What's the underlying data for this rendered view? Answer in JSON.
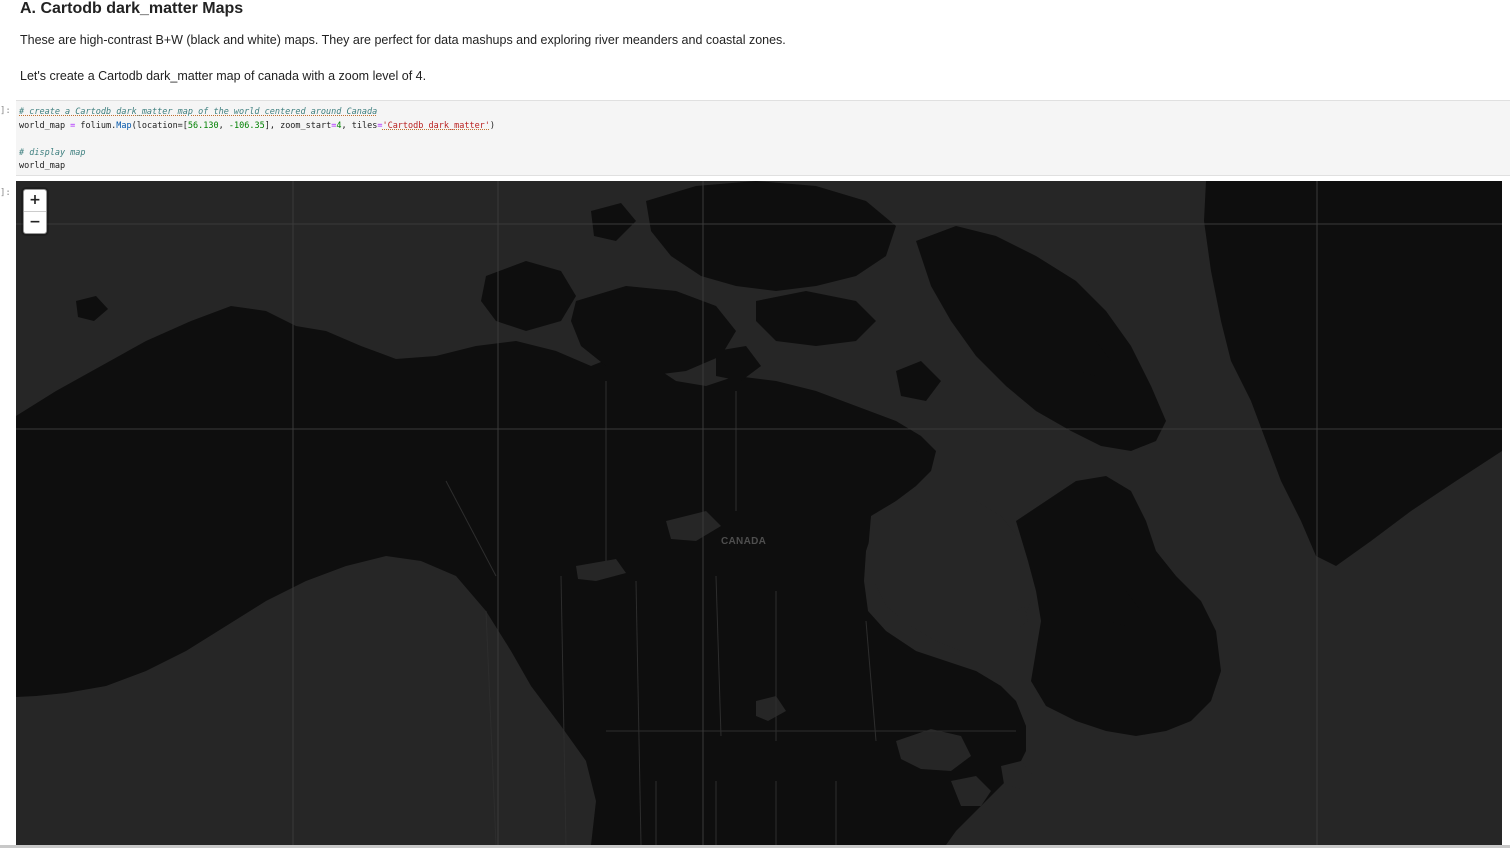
{
  "markdown": {
    "heading": "A. Cartodb dark_matter Maps",
    "para1": "These are high-contrast B+W (black and white) maps. They are perfect for data mashups and exploring river meanders and coastal zones.",
    "para2": "Let's create a Cartodb dark_matter map of canada with a zoom level of 4."
  },
  "code_cell": {
    "prompt": "]:",
    "comment1": "# create a Cartodb dark_matter map of the world centered around Canada",
    "line2": {
      "var": "world_map",
      "eq": " = ",
      "mod": "folium",
      "dot": ".",
      "cls": "Map",
      "open": "(location=[",
      "lat": "56.130",
      "sep": ", ",
      "lon": "-106.35",
      "mid": "], zoom_start",
      "eq2": "=",
      "zoom": "4",
      "tiles_kw": ", tiles",
      "eq3": "=",
      "tiles_val": "'Cartodb dark_matter'",
      "close": ")"
    },
    "comment2": "# display map",
    "line4": "world_map"
  },
  "output_cell": {
    "prompt": "]:"
  },
  "map": {
    "zoom_in": "+",
    "zoom_out": "−",
    "country_label": "CANADA",
    "center_lat": 56.13,
    "center_lon": -106.35,
    "zoom": 4,
    "tiles": "Cartodb dark_matter",
    "land_color": "#0e0e0e",
    "water_color": "#262626",
    "border_color": "#303030"
  }
}
